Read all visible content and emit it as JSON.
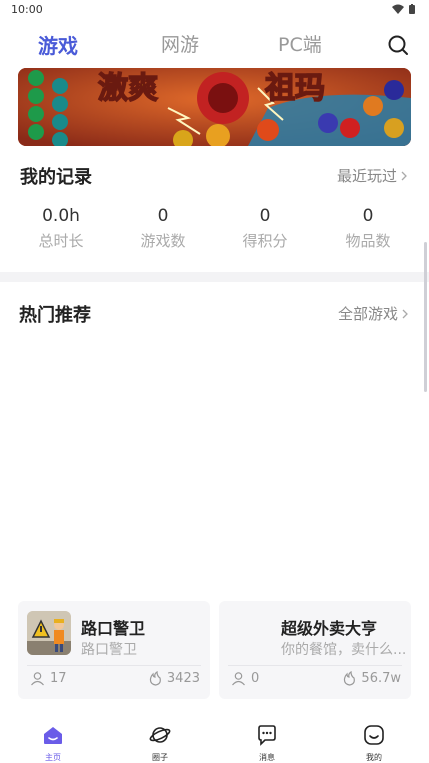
{
  "status": {
    "time": "10:00"
  },
  "tabs": [
    {
      "label": "游戏",
      "active": true
    },
    {
      "label": "网游",
      "active": false
    },
    {
      "label": "PC端",
      "active": false
    }
  ],
  "banner": {
    "text_left": "激爽",
    "text_right": "祖玛"
  },
  "records": {
    "title": "我的记录",
    "more": "最近玩过",
    "stats": [
      {
        "value": "0.0h",
        "label": "总时长"
      },
      {
        "value": "0",
        "label": "游戏数"
      },
      {
        "value": "0",
        "label": "得积分"
      },
      {
        "value": "0",
        "label": "物品数"
      }
    ]
  },
  "hot": {
    "title": "热门推荐",
    "more": "全部游戏",
    "cards": [
      {
        "name": "路口警卫",
        "desc": "路口警卫",
        "players": "17",
        "heat": "3423"
      },
      {
        "name": "超级外卖大亨",
        "desc": "你的餐馆，卖什么...",
        "players": "0",
        "heat": "56.7w"
      }
    ]
  },
  "bottom_nav": [
    {
      "label": "主页",
      "icon": "home-icon",
      "active": true
    },
    {
      "label": "圈子",
      "icon": "planet-icon",
      "active": false
    },
    {
      "label": "消息",
      "icon": "chat-icon",
      "active": false
    },
    {
      "label": "我的",
      "icon": "smile-icon",
      "active": false
    }
  ],
  "colors": {
    "accent": "#4a5bd8",
    "nav_active": "#6a5ce8"
  }
}
